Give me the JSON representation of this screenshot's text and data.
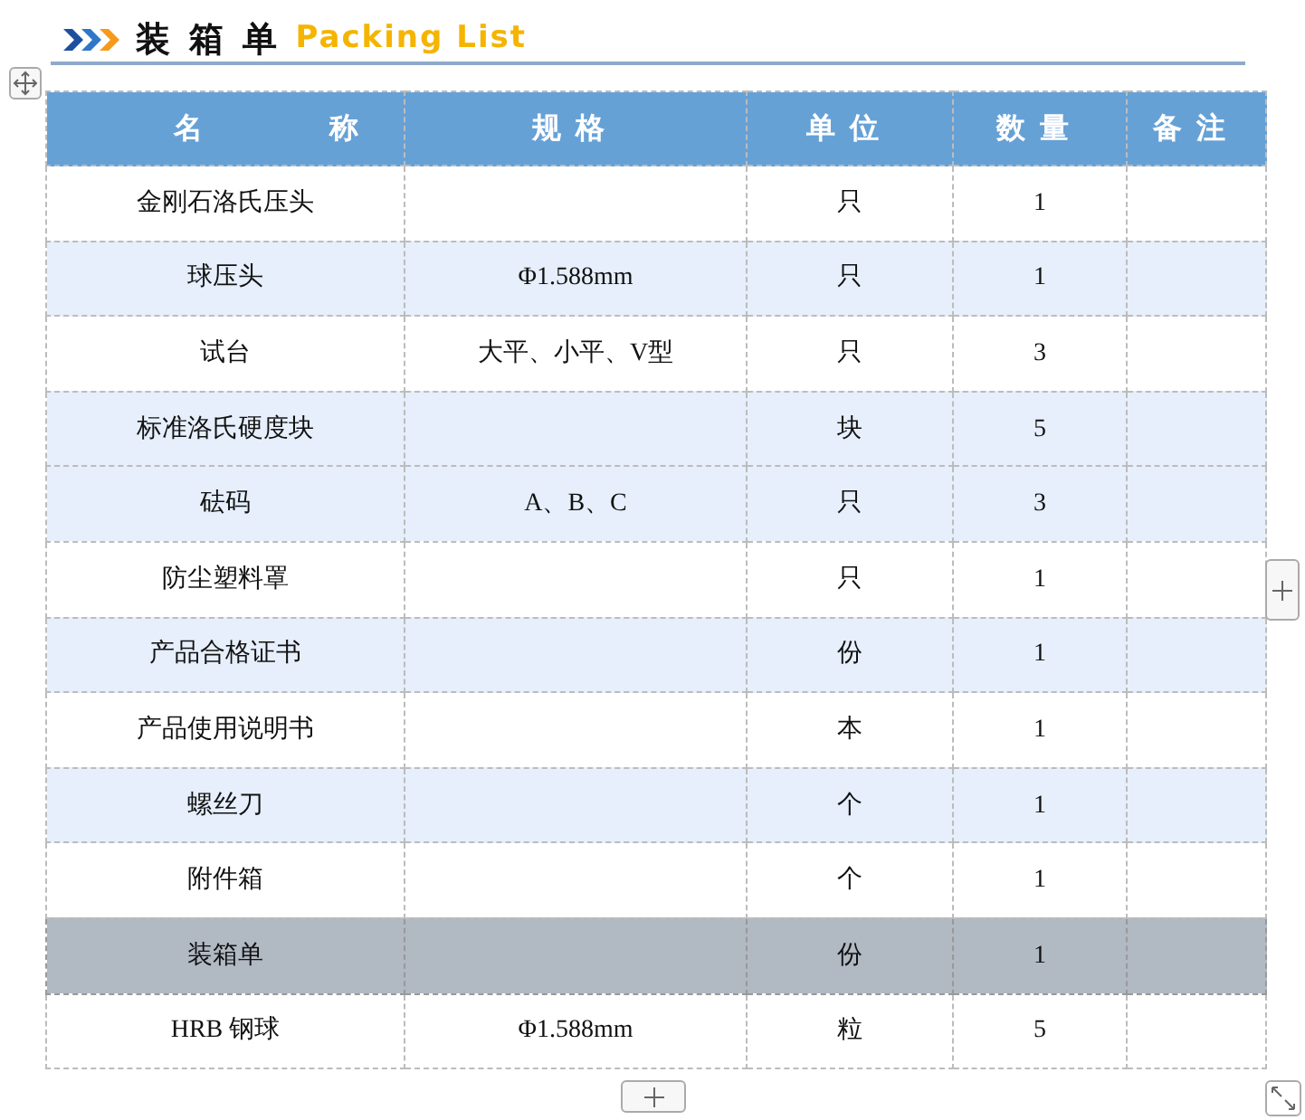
{
  "title": {
    "main": "装 箱 单",
    "sub": "Packing List"
  },
  "table": {
    "columns": [
      "名称",
      "规格",
      "单位",
      "数量",
      "备注"
    ],
    "rows": [
      {
        "cells": [
          "金刚石洛氏压头",
          "",
          "只",
          "1",
          ""
        ],
        "shaded": false,
        "selected": false
      },
      {
        "cells": [
          "球压头",
          "Φ1.588mm",
          "只",
          "1",
          ""
        ],
        "shaded": true,
        "selected": false
      },
      {
        "cells": [
          "试台",
          "大平、小平、V型",
          "只",
          "3",
          ""
        ],
        "shaded": false,
        "selected": false
      },
      {
        "cells": [
          "标准洛氏硬度块",
          "",
          "块",
          "5",
          ""
        ],
        "shaded": true,
        "selected": false
      },
      {
        "cells": [
          "砝码",
          "A、B、C",
          "只",
          "3",
          ""
        ],
        "shaded": true,
        "selected": false
      },
      {
        "cells": [
          "防尘塑料罩",
          "",
          "只",
          "1",
          ""
        ],
        "shaded": false,
        "selected": false
      },
      {
        "cells": [
          "产品合格证书",
          "",
          "份",
          "1",
          ""
        ],
        "shaded": true,
        "selected": false
      },
      {
        "cells": [
          "产品使用说明书",
          "",
          "本",
          "1",
          ""
        ],
        "shaded": false,
        "selected": false
      },
      {
        "cells": [
          "螺丝刀",
          "",
          "个",
          "1",
          ""
        ],
        "shaded": true,
        "selected": false
      },
      {
        "cells": [
          "附件箱",
          "",
          "个",
          "1",
          ""
        ],
        "shaded": false,
        "selected": false
      },
      {
        "cells": [
          "装箱单",
          "",
          "份",
          "1",
          ""
        ],
        "shaded": false,
        "selected": true
      },
      {
        "cells": [
          "HRB 钢球",
          "Φ1.588mm",
          "粒",
          "5",
          ""
        ],
        "shaded": false,
        "selected": false
      }
    ]
  }
}
